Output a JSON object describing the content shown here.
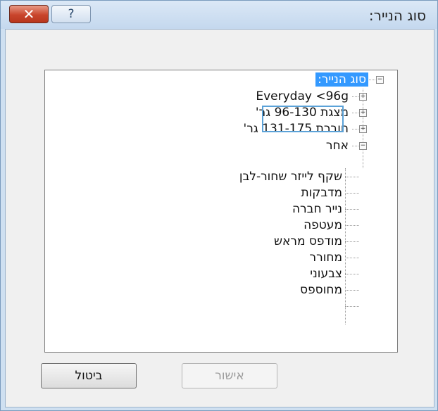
{
  "window": {
    "title": "סוג הנייר:"
  },
  "titlebar": {
    "close_glyph": "✕",
    "help_glyph": "?"
  },
  "tree": {
    "root": {
      "label": "סוג הנייר:",
      "expander": "−"
    },
    "nodes": [
      {
        "label": "Everyday <96g",
        "expander": "+"
      },
      {
        "label": "מצגת 96-130 גר'",
        "expander": "+"
      },
      {
        "label": "חוברת 131-175 גר'",
        "expander": "+"
      },
      {
        "label": "אחר",
        "expander": "−"
      }
    ],
    "other_children": [
      "שקף לייזר שחור-לבן",
      "מדבקות",
      "נייר חברה",
      "מעטפה",
      "מודפס מראש",
      "מחורר",
      "צבעוני",
      "מחוספס"
    ]
  },
  "buttons": {
    "ok": "אישור",
    "cancel": "ביטול"
  }
}
